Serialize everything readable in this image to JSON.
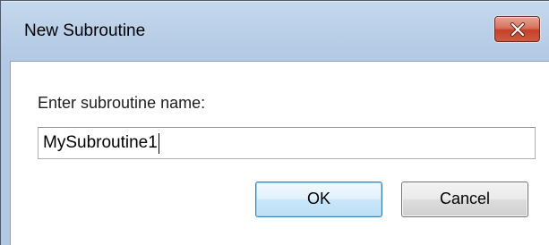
{
  "window": {
    "title": "New Subroutine",
    "close_icon": "close-x-icon",
    "accent_color": "#c4412a",
    "frame_color": "#b9cee7"
  },
  "form": {
    "prompt_label": "Enter subroutine name:",
    "name_value": "MySubroutine1"
  },
  "buttons": {
    "ok_label": "OK",
    "cancel_label": "Cancel"
  }
}
